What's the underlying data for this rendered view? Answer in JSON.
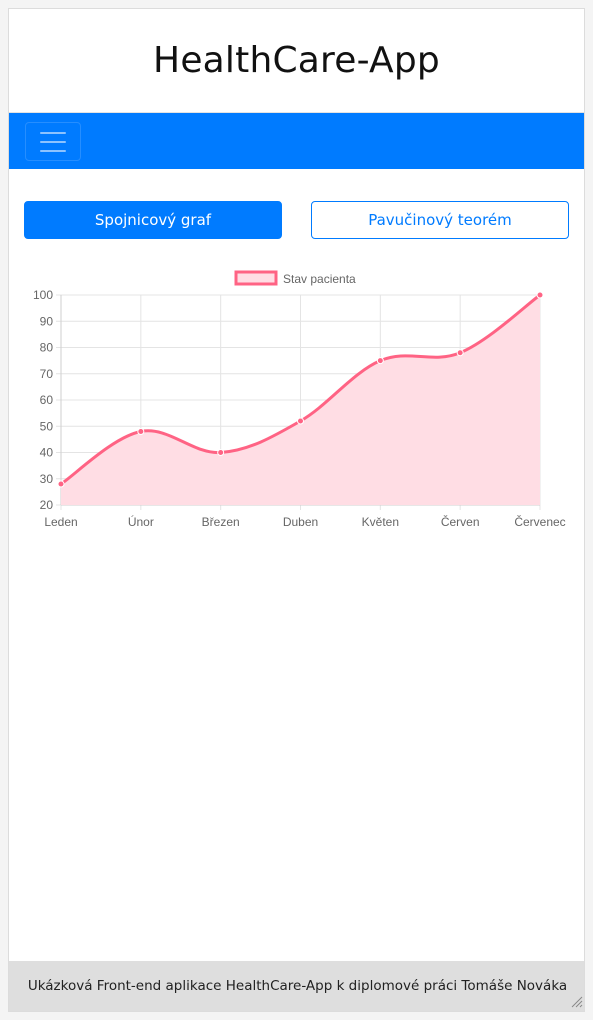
{
  "header": {
    "title": "HealthCare-App"
  },
  "navbar": {
    "toggler_icon": "hamburger-menu-icon",
    "color": "#007bff"
  },
  "buttons": {
    "line_chart": "Spojnicový graf",
    "radar_chart": "Pavučinový teorém"
  },
  "chart_data": {
    "type": "line",
    "categories": [
      "Leden",
      "Únor",
      "Březen",
      "Duben",
      "Květen",
      "Červen",
      "Červenec"
    ],
    "series": [
      {
        "name": "Stav pacienta",
        "values": [
          28,
          48,
          40,
          52,
          75,
          78,
          100
        ],
        "color": "#ff6384",
        "fill": "#ffdde4"
      }
    ],
    "yticks": [
      100,
      90,
      80,
      70,
      60,
      50,
      40,
      30,
      20
    ],
    "ylim": [
      20,
      100
    ],
    "grid": true,
    "legend": "top-center"
  },
  "footer": {
    "text": "Ukázková Front-end aplikace HealthCare-App k diplomové práci Tomáše Nováka"
  }
}
